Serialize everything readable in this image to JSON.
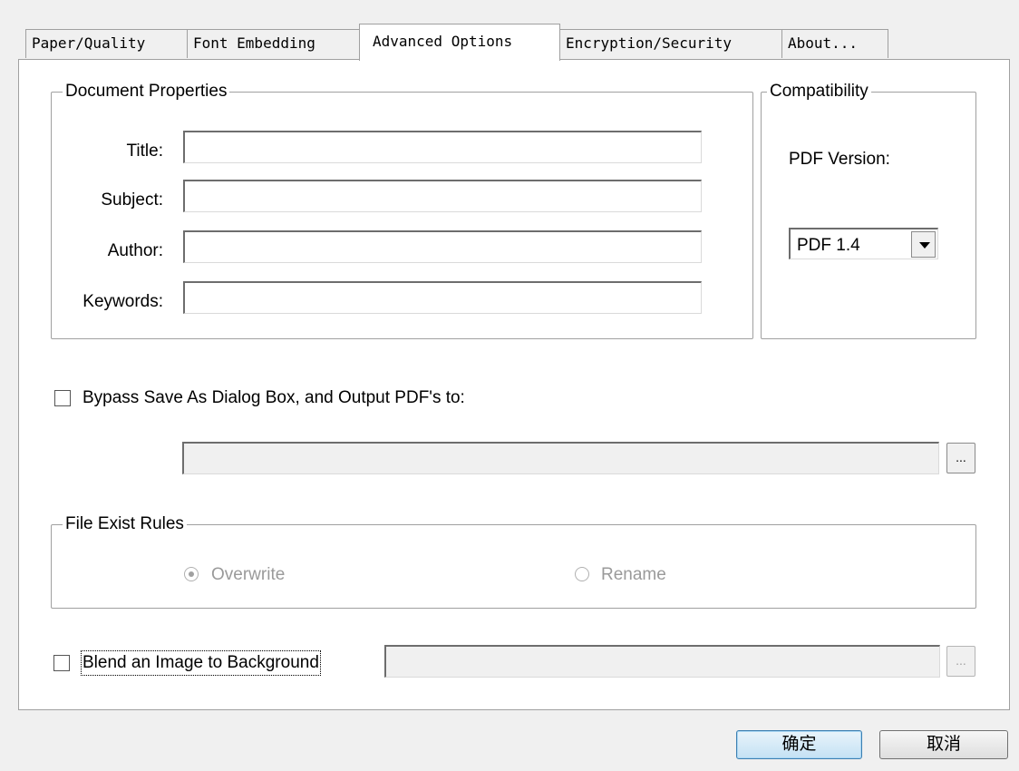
{
  "tabs": [
    {
      "label": "Paper/Quality"
    },
    {
      "label": "Font Embedding"
    },
    {
      "label": "Advanced Options"
    },
    {
      "label": "Encryption/Security"
    },
    {
      "label": "About..."
    }
  ],
  "active_tab": "Advanced Options",
  "document_properties": {
    "legend": "Document Properties",
    "fields": [
      {
        "label": "Title:",
        "value": ""
      },
      {
        "label": "Subject:",
        "value": ""
      },
      {
        "label": "Author:",
        "value": ""
      },
      {
        "label": "Keywords:",
        "value": ""
      }
    ]
  },
  "compatibility": {
    "legend": "Compatibility",
    "pdf_version_label": "PDF Version:",
    "pdf_version_value": "PDF 1.4"
  },
  "bypass": {
    "label": "Bypass Save As Dialog Box, and Output PDF's to:",
    "checked": false,
    "path_value": "",
    "browse_label": "..."
  },
  "file_exist_rules": {
    "legend": "File Exist Rules",
    "options": [
      {
        "label": "Overwrite",
        "selected": true
      },
      {
        "label": "Rename",
        "selected": false
      }
    ]
  },
  "blend": {
    "label": "Blend an Image to Background",
    "checked": false,
    "path_value": "",
    "browse_label": "..."
  },
  "buttons": {
    "ok": "确定",
    "cancel": "取消"
  }
}
